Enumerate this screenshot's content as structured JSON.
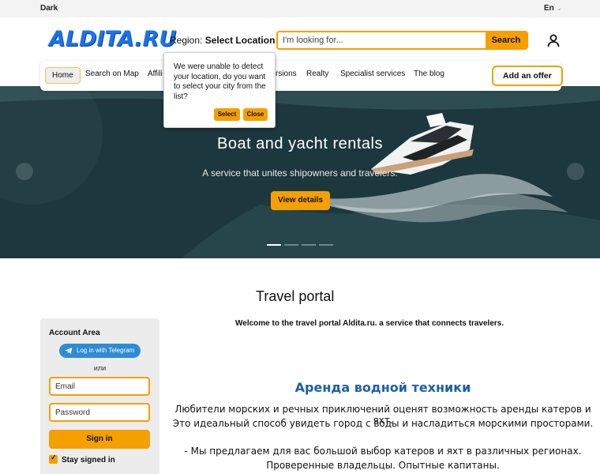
{
  "topbar": {
    "theme_label": "Dark",
    "language": "En"
  },
  "header": {
    "logo": "ALDITA.RU",
    "region_label": "Region:",
    "region_value": "Select Location",
    "search": {
      "placeholder": "I'm looking for...",
      "button": "Search"
    }
  },
  "nav": {
    "items": [
      "Home",
      "Search on Map",
      "Affili",
      "rsions",
      "Realty",
      "Specialist services",
      "The blog"
    ],
    "add_offer": "Add an offer"
  },
  "location_popup": {
    "message": "We were unable to detect your location, do you want to select your city from the list?",
    "select": "Select",
    "close": "Close"
  },
  "hero": {
    "title": "Boat and yacht rentals",
    "subtitle": "A service that unites shipowners and travelers.",
    "button": "View details",
    "slide_count": 4,
    "active_slide": 1
  },
  "main": {
    "title": "Travel portal",
    "welcome": "Welcome to the travel portal Aldita.ru. a service that connects travelers."
  },
  "account": {
    "title": "Account Area",
    "telegram": "Log in with Telegram",
    "or": "или",
    "email_placeholder": "Email",
    "password_placeholder": "Password",
    "signin": "Sign in",
    "stay": "Stay signed in",
    "stay_checked": true
  },
  "article": {
    "title": "Аренда водной техники",
    "p1": "Любители морских и речных приключений оценят возможность аренды катеров и яхт.",
    "p2": "Это идеальный способ увидеть город с воды и насладиться морскими просторами.",
    "p3": "- Мы предлагаем для вас большой выбор катеров и яхт в различных регионах.",
    "p4": "Проверенные владельцы. Опытные капитаны."
  },
  "colors": {
    "accent": "#f5a000",
    "brand_blue": "#1a73e8",
    "heading_blue": "#1d5fa8"
  }
}
